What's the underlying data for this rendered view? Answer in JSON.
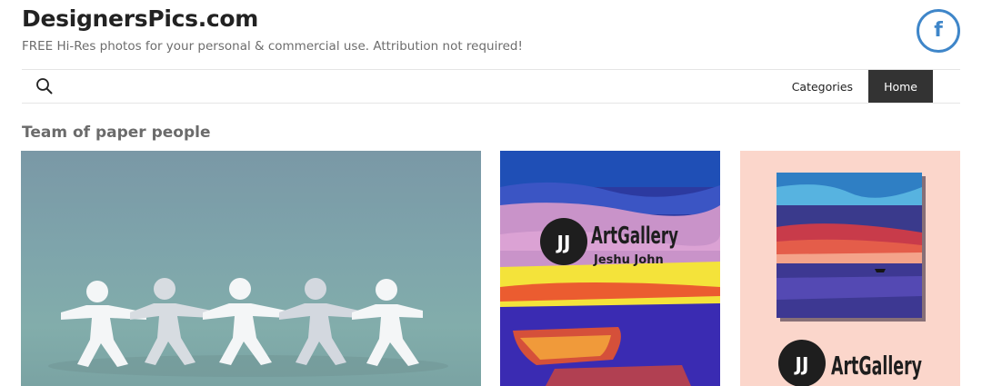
{
  "site": {
    "title": "DesignersPics.com",
    "tagline": "FREE Hi-Res photos for your personal & commercial use. Attribution not required!",
    "social_icon": "facebook-icon",
    "social_letter": "f"
  },
  "nav": {
    "search_icon": "search-icon",
    "items": [
      {
        "label": "Categories",
        "active": false
      },
      {
        "label": "Home",
        "active": true
      }
    ]
  },
  "post": {
    "title": "Team of paper people"
  },
  "gallery": {
    "items": [
      {
        "subject": "paper-people-chain"
      },
      {
        "subject": "art-gallery-boat-painting",
        "logo_title": "ArtGallery",
        "logo_subtitle": "Jeshu John"
      },
      {
        "subject": "art-gallery-sunset-painting",
        "logo_title": "ArtGallery"
      }
    ]
  },
  "colors": {
    "facebook": "#3f86c9",
    "nav_active_bg": "#333333",
    "tagline": "#6d6d6d",
    "post_title": "#6b6b6b"
  }
}
